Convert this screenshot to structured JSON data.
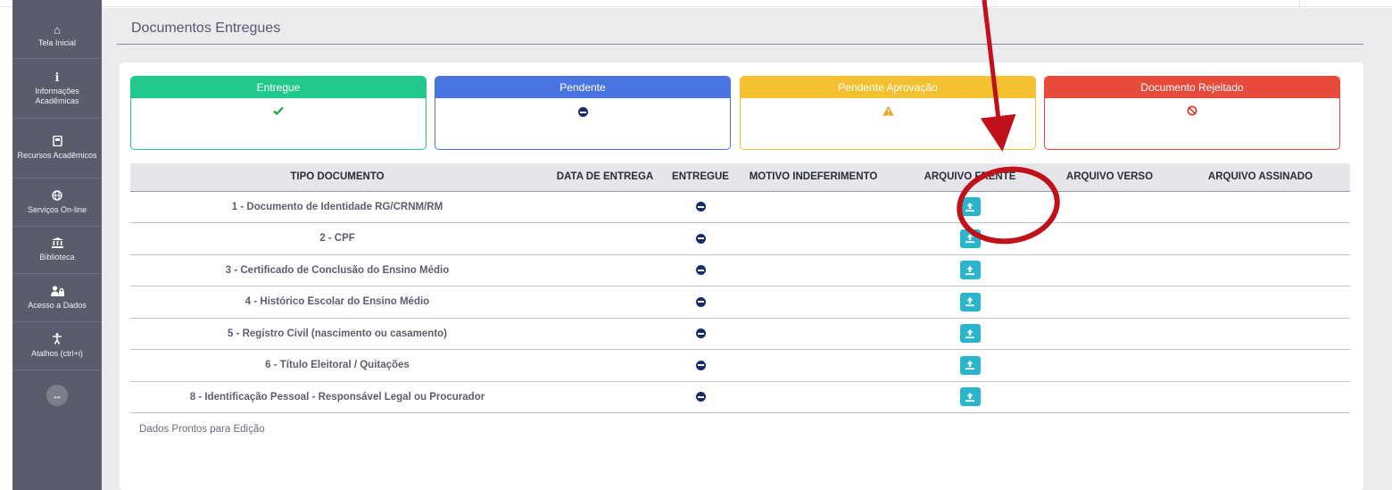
{
  "sidebar": {
    "items": [
      {
        "label": "Tela Inicial",
        "icon": "home-icon"
      },
      {
        "label": "Informações Acadêmicas",
        "icon": "info-icon"
      },
      {
        "label": "Recursos Acadêmicos",
        "icon": "book-icon"
      },
      {
        "label": "Serviços On-line",
        "icon": "globe-icon"
      },
      {
        "label": "Biblioteca",
        "icon": "library-icon"
      },
      {
        "label": "Acesso a Dados",
        "icon": "users-lock-icon"
      },
      {
        "label": "Atalhos (ctrl+i)",
        "icon": "accessibility-icon"
      }
    ],
    "toggle_icon": "expand-arrows-icon"
  },
  "page": {
    "title": "Documentos Entregues"
  },
  "legend": [
    {
      "label": "Entregue",
      "color": "#20c98a",
      "icon": "check-icon"
    },
    {
      "label": "Pendente",
      "color": "#4a74e0",
      "icon": "minus-circle-icon"
    },
    {
      "label": "Pendente Aprovação",
      "color": "#f5c030",
      "icon": "warning-icon"
    },
    {
      "label": "Documento Rejeitado",
      "color": "#e74a3b",
      "icon": "ban-icon"
    }
  ],
  "table": {
    "headers": [
      "TIPO DOCUMENTO",
      "DATA DE ENTREGA",
      "ENTREGUE",
      "MOTIVO INDEFERIMENTO",
      "ARQUIVO FRENTE",
      "ARQUIVO VERSO",
      "ARQUIVO ASSINADO"
    ],
    "rows": [
      {
        "tipo": "1 - Documento de Identidade RG/CRNM/RM",
        "data": "",
        "motivo": ""
      },
      {
        "tipo": "2 - CPF",
        "data": "",
        "motivo": ""
      },
      {
        "tipo": "3 - Certificado de Conclusão do Ensino Médio",
        "data": "",
        "motivo": ""
      },
      {
        "tipo": "4 - Histórico Escolar do Ensino Médio",
        "data": "",
        "motivo": ""
      },
      {
        "tipo": "5 - Registro Civil (nascimento ou casamento)",
        "data": "",
        "motivo": ""
      },
      {
        "tipo": "6 - Título Eleitoral / Quitações",
        "data": "",
        "motivo": ""
      },
      {
        "tipo": "8 - Identificação Pessoal - Responsável Legal ou Procurador",
        "data": "",
        "motivo": ""
      }
    ],
    "entregue_icon": "minus-circle-icon",
    "upload_icon": "upload-icon"
  },
  "footer": {
    "status": "Dados Prontos para Edição"
  },
  "colors": {
    "sidebar_bg": "#5a5c6b",
    "upload_button": "#2bb5cc",
    "annotation_red": "#c0101a"
  }
}
